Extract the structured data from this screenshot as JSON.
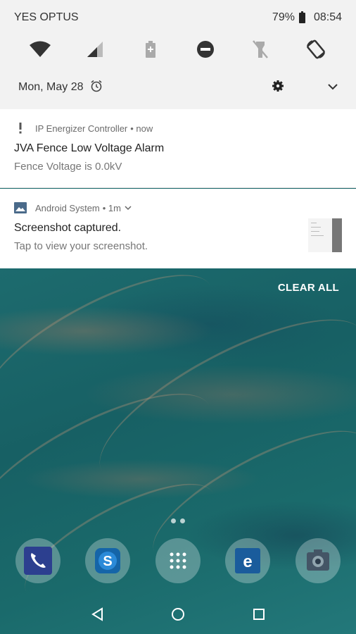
{
  "status_bar": {
    "carrier": "YES OPTUS",
    "battery_percent": "79%",
    "time": "08:54"
  },
  "quick_settings": {
    "tiles": [
      "wifi-icon",
      "cellular-signal-icon",
      "battery-saver-icon",
      "do-not-disturb-icon",
      "flashlight-off-icon",
      "auto-rotate-icon"
    ],
    "date": "Mon, May 28"
  },
  "notifications": [
    {
      "app": "IP Energizer Controller",
      "time": "• now",
      "title": "JVA Fence Low Voltage Alarm",
      "text": "Fence Voltage is 0.0kV"
    },
    {
      "app": "Android System",
      "time": "• 1m",
      "title": "Screenshot captured.",
      "text": "Tap to view your screenshot."
    }
  ],
  "clear_all_label": "CLEAR ALL",
  "dock": [
    "phone-icon",
    "skype-icon",
    "app-drawer-icon",
    "edge-browser-icon",
    "camera-icon"
  ],
  "colors": {
    "shade_bg": "#f2f2f2",
    "notification_bg": "#ffffff",
    "wallpaper_teal": "#1d6b6e"
  }
}
